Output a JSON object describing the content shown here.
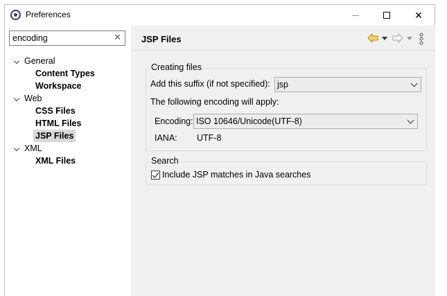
{
  "window": {
    "title": "Preferences",
    "minimize_label": "",
    "maximize_label": "",
    "close_label": "✕"
  },
  "sidebar": {
    "filter": {
      "value": "encoding",
      "clear_icon": "✕"
    },
    "tree": [
      {
        "label": "General",
        "expanded": true,
        "children": [
          "Content Types",
          "Workspace"
        ]
      },
      {
        "label": "Web",
        "expanded": true,
        "children": [
          "CSS Files",
          "HTML Files",
          "JSP Files"
        ]
      },
      {
        "label": "XML",
        "expanded": true,
        "children": [
          "XML Files"
        ]
      }
    ],
    "selected": "JSP Files"
  },
  "page": {
    "title": "JSP Files",
    "nav_icons": [
      "back-arrow-icon",
      "dropdown-icon",
      "forward-arrow-icon",
      "dropdown-icon",
      "menu-icon"
    ]
  },
  "creating_files": {
    "title": "Creating files",
    "suffix_label": "Add this suffix (if not specified):",
    "suffix_value": "jsp",
    "encoding_note": "The following encoding will apply:",
    "encoding_label": "Encoding:",
    "encoding_value": "ISO 10646/Unicode(UTF-8)",
    "iana_label": "IANA:",
    "iana_value": "UTF-8"
  },
  "search": {
    "title": "Search",
    "include_label": "Include JSP matches in Java searches",
    "include_checked": true
  },
  "colors": {
    "accent_back": "#d4a017",
    "selection": "#d9d9d9"
  }
}
